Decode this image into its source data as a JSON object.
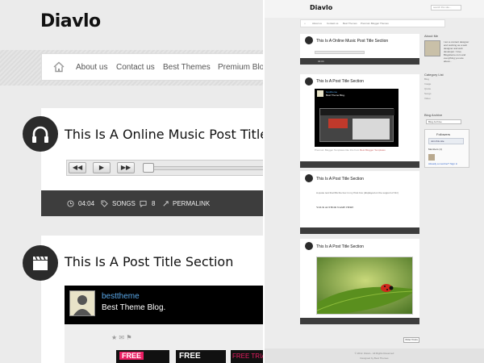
{
  "site": {
    "logo": "Diavlo"
  },
  "nav": {
    "items": [
      "About us",
      "Contact us",
      "Best Themes",
      "Premium Blogger Themes"
    ]
  },
  "posts": [
    {
      "title": "This Is A Online Music Post Title Section",
      "icon": "headphones-icon"
    },
    {
      "title": "This Is A Post Title Section",
      "icon": "clapperboard-icon"
    },
    {
      "title": "This Is A Post Title Section",
      "icon": "quote-icon"
    },
    {
      "title": "This Is A Post Title Section",
      "icon": "image-icon"
    }
  ],
  "meta": {
    "duration": "04:04",
    "category": "SONGS",
    "comments": "8",
    "permalink": "PERMALINK"
  },
  "embed": {
    "user": "besttheme",
    "description": "Best Theme Blog.",
    "social_icons": "★ ✉ ⚑",
    "ad1": "FREE",
    "ad2": "FREE",
    "ad3": "FREE TRIAL"
  },
  "preview": {
    "search_placeholder": "search this site...",
    "embed_caption_text": "Premium Blogger Templates like this from",
    "embed_caption_link": "Best Blogger Templates",
    "quote_text": "A quote text that fills the box in my Post box (displayed on the support of Frc)",
    "quote_author": "YOUR AUTHOR NAME HERE",
    "older_posts": "Older Posts",
    "footer_line1": "© 2012. Diavlo - All Rights Reserved",
    "footer_line2": "Designed by Best Themes"
  },
  "sidebar": {
    "about_heading": "About Me",
    "about_text": "I am a content designer and working as a web designer and web developer. I love Blogsiteme.com and everything you are about...",
    "category_heading": "Category List",
    "categories": [
      "Blog",
      "Image",
      "Quote",
      "Songs",
      "Video"
    ],
    "archive_heading": "Blog Archive",
    "archive_select": "Blog Archive",
    "followers_heading": "Followers",
    "followers_button": "Join this site",
    "followers_count": "Members (1)",
    "followers_more": "Already a member? Sign in"
  },
  "colors": {
    "dark_band": "#3d3d3d",
    "circle": "#2b2b2b",
    "link": "#5aa7e8",
    "accent": "#e91e63"
  }
}
